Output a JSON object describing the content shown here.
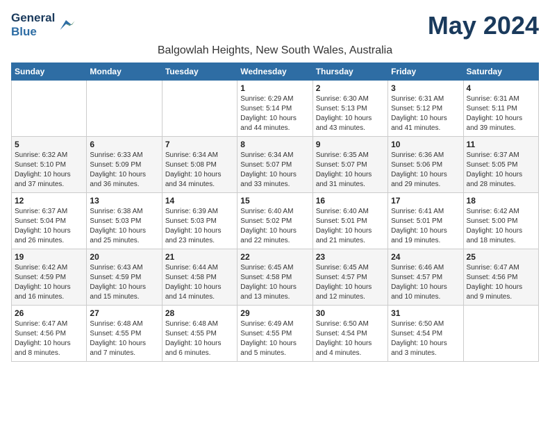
{
  "header": {
    "logo_line1": "General",
    "logo_line2": "Blue",
    "month_year": "May 2024",
    "subtitle": "Balgowlah Heights, New South Wales, Australia"
  },
  "days_of_week": [
    "Sunday",
    "Monday",
    "Tuesday",
    "Wednesday",
    "Thursday",
    "Friday",
    "Saturday"
  ],
  "weeks": [
    [
      {
        "day": "",
        "info": ""
      },
      {
        "day": "",
        "info": ""
      },
      {
        "day": "",
        "info": ""
      },
      {
        "day": "1",
        "info": "Sunrise: 6:29 AM\nSunset: 5:14 PM\nDaylight: 10 hours\nand 44 minutes."
      },
      {
        "day": "2",
        "info": "Sunrise: 6:30 AM\nSunset: 5:13 PM\nDaylight: 10 hours\nand 43 minutes."
      },
      {
        "day": "3",
        "info": "Sunrise: 6:31 AM\nSunset: 5:12 PM\nDaylight: 10 hours\nand 41 minutes."
      },
      {
        "day": "4",
        "info": "Sunrise: 6:31 AM\nSunset: 5:11 PM\nDaylight: 10 hours\nand 39 minutes."
      }
    ],
    [
      {
        "day": "5",
        "info": "Sunrise: 6:32 AM\nSunset: 5:10 PM\nDaylight: 10 hours\nand 37 minutes."
      },
      {
        "day": "6",
        "info": "Sunrise: 6:33 AM\nSunset: 5:09 PM\nDaylight: 10 hours\nand 36 minutes."
      },
      {
        "day": "7",
        "info": "Sunrise: 6:34 AM\nSunset: 5:08 PM\nDaylight: 10 hours\nand 34 minutes."
      },
      {
        "day": "8",
        "info": "Sunrise: 6:34 AM\nSunset: 5:07 PM\nDaylight: 10 hours\nand 33 minutes."
      },
      {
        "day": "9",
        "info": "Sunrise: 6:35 AM\nSunset: 5:07 PM\nDaylight: 10 hours\nand 31 minutes."
      },
      {
        "day": "10",
        "info": "Sunrise: 6:36 AM\nSunset: 5:06 PM\nDaylight: 10 hours\nand 29 minutes."
      },
      {
        "day": "11",
        "info": "Sunrise: 6:37 AM\nSunset: 5:05 PM\nDaylight: 10 hours\nand 28 minutes."
      }
    ],
    [
      {
        "day": "12",
        "info": "Sunrise: 6:37 AM\nSunset: 5:04 PM\nDaylight: 10 hours\nand 26 minutes."
      },
      {
        "day": "13",
        "info": "Sunrise: 6:38 AM\nSunset: 5:03 PM\nDaylight: 10 hours\nand 25 minutes."
      },
      {
        "day": "14",
        "info": "Sunrise: 6:39 AM\nSunset: 5:03 PM\nDaylight: 10 hours\nand 23 minutes."
      },
      {
        "day": "15",
        "info": "Sunrise: 6:40 AM\nSunset: 5:02 PM\nDaylight: 10 hours\nand 22 minutes."
      },
      {
        "day": "16",
        "info": "Sunrise: 6:40 AM\nSunset: 5:01 PM\nDaylight: 10 hours\nand 21 minutes."
      },
      {
        "day": "17",
        "info": "Sunrise: 6:41 AM\nSunset: 5:01 PM\nDaylight: 10 hours\nand 19 minutes."
      },
      {
        "day": "18",
        "info": "Sunrise: 6:42 AM\nSunset: 5:00 PM\nDaylight: 10 hours\nand 18 minutes."
      }
    ],
    [
      {
        "day": "19",
        "info": "Sunrise: 6:42 AM\nSunset: 4:59 PM\nDaylight: 10 hours\nand 16 minutes."
      },
      {
        "day": "20",
        "info": "Sunrise: 6:43 AM\nSunset: 4:59 PM\nDaylight: 10 hours\nand 15 minutes."
      },
      {
        "day": "21",
        "info": "Sunrise: 6:44 AM\nSunset: 4:58 PM\nDaylight: 10 hours\nand 14 minutes."
      },
      {
        "day": "22",
        "info": "Sunrise: 6:45 AM\nSunset: 4:58 PM\nDaylight: 10 hours\nand 13 minutes."
      },
      {
        "day": "23",
        "info": "Sunrise: 6:45 AM\nSunset: 4:57 PM\nDaylight: 10 hours\nand 12 minutes."
      },
      {
        "day": "24",
        "info": "Sunrise: 6:46 AM\nSunset: 4:57 PM\nDaylight: 10 hours\nand 10 minutes."
      },
      {
        "day": "25",
        "info": "Sunrise: 6:47 AM\nSunset: 4:56 PM\nDaylight: 10 hours\nand 9 minutes."
      }
    ],
    [
      {
        "day": "26",
        "info": "Sunrise: 6:47 AM\nSunset: 4:56 PM\nDaylight: 10 hours\nand 8 minutes."
      },
      {
        "day": "27",
        "info": "Sunrise: 6:48 AM\nSunset: 4:55 PM\nDaylight: 10 hours\nand 7 minutes."
      },
      {
        "day": "28",
        "info": "Sunrise: 6:48 AM\nSunset: 4:55 PM\nDaylight: 10 hours\nand 6 minutes."
      },
      {
        "day": "29",
        "info": "Sunrise: 6:49 AM\nSunset: 4:55 PM\nDaylight: 10 hours\nand 5 minutes."
      },
      {
        "day": "30",
        "info": "Sunrise: 6:50 AM\nSunset: 4:54 PM\nDaylight: 10 hours\nand 4 minutes."
      },
      {
        "day": "31",
        "info": "Sunrise: 6:50 AM\nSunset: 4:54 PM\nDaylight: 10 hours\nand 3 minutes."
      },
      {
        "day": "",
        "info": ""
      }
    ]
  ]
}
